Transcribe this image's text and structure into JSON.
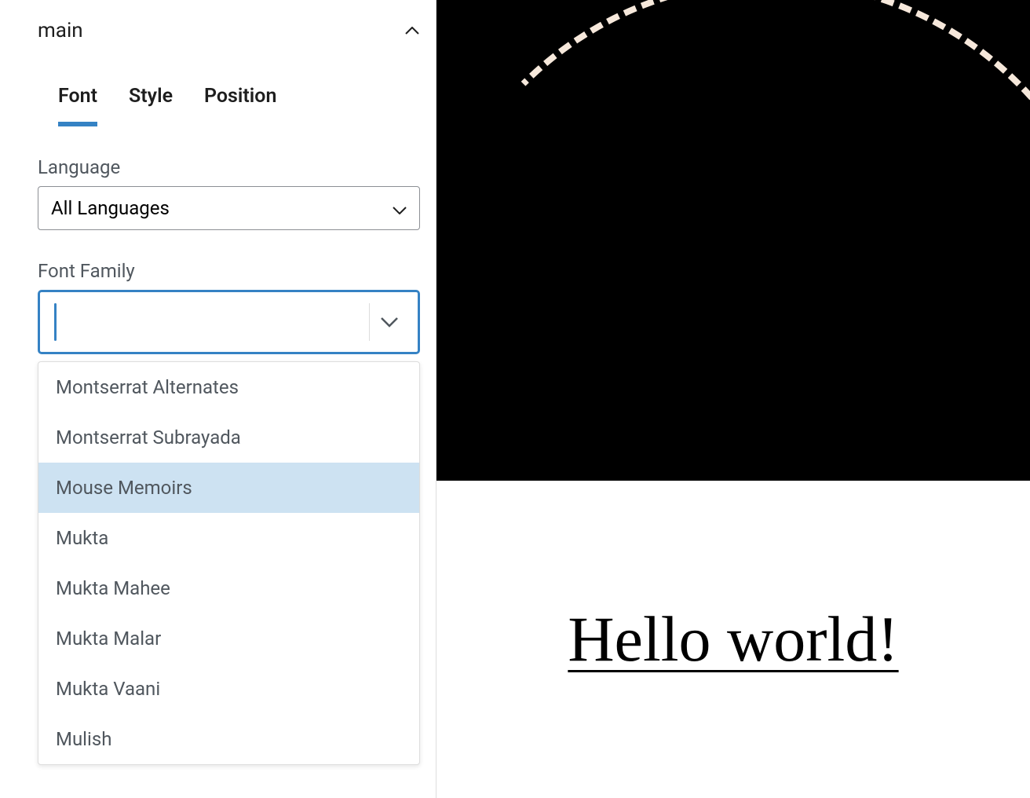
{
  "panel": {
    "title": "main"
  },
  "tabs": [
    {
      "label": "Font",
      "active": true
    },
    {
      "label": "Style",
      "active": false
    },
    {
      "label": "Position",
      "active": false
    }
  ],
  "language": {
    "label": "Language",
    "value": "All Languages"
  },
  "fontFamily": {
    "label": "Font Family",
    "value": "",
    "options": [
      {
        "label": "Montserrat Alternates",
        "highlighted": false
      },
      {
        "label": "Montserrat Subrayada",
        "highlighted": false
      },
      {
        "label": "Mouse Memoirs",
        "highlighted": true
      },
      {
        "label": "Mukta",
        "highlighted": false
      },
      {
        "label": "Mukta Mahee",
        "highlighted": false
      },
      {
        "label": "Mukta Malar",
        "highlighted": false
      },
      {
        "label": "Mukta Vaani",
        "highlighted": false
      },
      {
        "label": "Mulish",
        "highlighted": false
      }
    ]
  },
  "preview": {
    "headline": "Hello world!"
  }
}
